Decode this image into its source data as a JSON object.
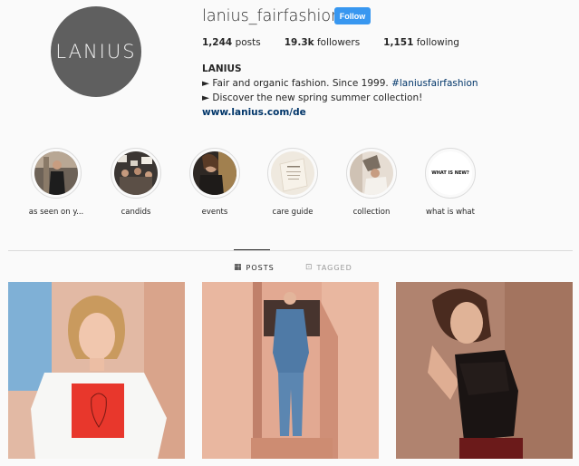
{
  "profile": {
    "avatar_logo_text": "LANIUS",
    "username": "lanius_fairfashion",
    "follow_label": "Follow",
    "stats": {
      "posts_count": "1,244",
      "posts_label": "posts",
      "followers_count": "19.3k",
      "followers_label": "followers",
      "following_count": "1,151",
      "following_label": "following"
    },
    "bio": {
      "name": "LANIUS",
      "line1_text": "► Fair and organic fashion. Since 1999. ",
      "line1_hashtag": "#laniusfairfashion",
      "line2_text": "► Discover the new spring summer collection!",
      "website": "www.lanius.com/de"
    }
  },
  "highlights": [
    {
      "label": "as seen on y...",
      "icon": "highlight-photo"
    },
    {
      "label": "candids",
      "icon": "highlight-photo"
    },
    {
      "label": "events",
      "icon": "highlight-photo"
    },
    {
      "label": "care guide",
      "icon": "highlight-photo"
    },
    {
      "label": "collection",
      "icon": "highlight-photo"
    },
    {
      "label": "what is what",
      "cover_text": "WHAT IS NEW?"
    }
  ],
  "tabs": {
    "posts_label": "POSTS",
    "tagged_label": "TAGGED"
  },
  "colors": {
    "follow_button": "#3897f0",
    "link": "#003569",
    "avatar_bg": "#5f5f5f"
  }
}
